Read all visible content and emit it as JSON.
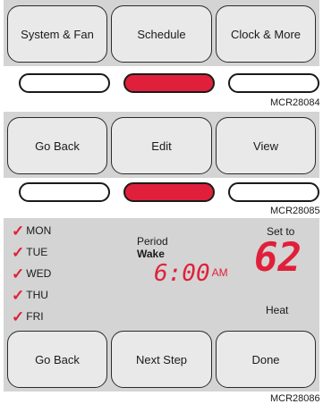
{
  "panel1": {
    "buttons": [
      "System & Fan",
      "Schedule",
      "Clock & More"
    ],
    "indicator_active": 1,
    "code": "MCR28084"
  },
  "panel2": {
    "buttons": [
      "Go Back",
      "Edit",
      "View"
    ],
    "indicator_active": 1,
    "code": "MCR28085"
  },
  "panel3": {
    "days": [
      "MON",
      "TUE",
      "WED",
      "THU",
      "FRI"
    ],
    "period_label": "Period",
    "period_value": "Wake",
    "time": "6:00",
    "ampm": "AM",
    "set_to_label": "Set to",
    "setpoint": "62",
    "mode": "Heat",
    "buttons": [
      "Go Back",
      "Next Step",
      "Done"
    ],
    "code": "MCR28086"
  },
  "colors": {
    "accent_red": "#e0203a",
    "panel_gray": "#d4d4d4",
    "button_face": "#e9e9e9"
  },
  "icons": {
    "day_check": "checkmark-icon"
  }
}
